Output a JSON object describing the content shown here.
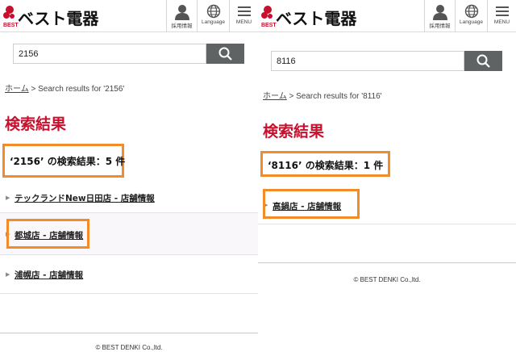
{
  "header": {
    "brand": "ベスト電器",
    "brand_sub": "BEST",
    "recruit_label": "採用情報",
    "language_label": "Language",
    "menu_label": "MENU"
  },
  "left": {
    "search_value": "2156",
    "breadcrumb_home": "ホーム",
    "breadcrumb_rest": " > Search results for '2156'",
    "page_title": "検索結果",
    "result_count": "‘2156’ の検索結果：5 件",
    "results": [
      "テックランドNew日田店 - 店舗情報",
      "都城店 - 店舗情報",
      "浦幌店 - 店舗情報"
    ],
    "copyright": "© BEST DENKI Co.,ltd."
  },
  "right": {
    "search_value": "8116",
    "breadcrumb_home": "ホーム",
    "breadcrumb_rest": " > Search results for '8116'",
    "page_title": "検索結果",
    "result_count": "‘8116’ の検索結果：1 件",
    "results": [
      "高鍋店 - 店舗情報"
    ],
    "copyright": "© BEST DENKI Co.,ltd."
  },
  "colors": {
    "brand_red": "#c8102e",
    "highlight_orange": "#f28c28",
    "search_button": "#5f6364"
  },
  "icons": [
    "person-icon",
    "globe-icon",
    "hamburger-icon",
    "search-icon",
    "triangle-bullet-icon"
  ]
}
